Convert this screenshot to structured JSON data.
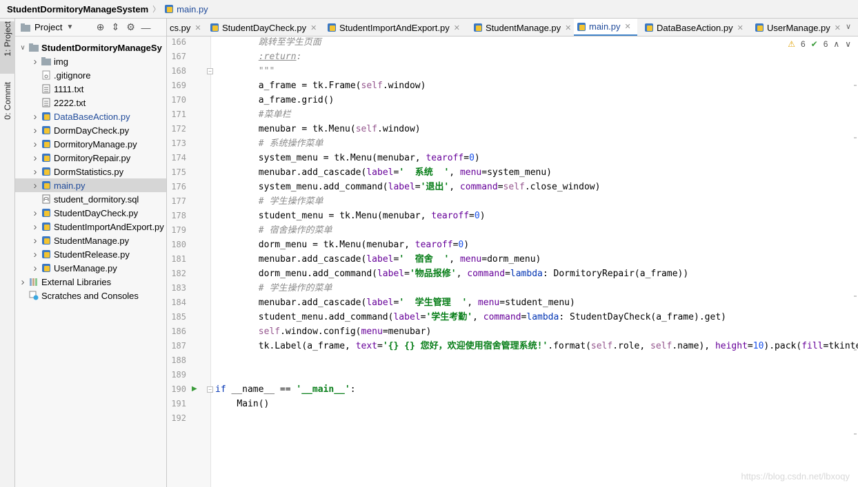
{
  "navbar": {
    "project": "StudentDormitoryManageSystem",
    "file": "main.py"
  },
  "toolstrip": {
    "project_tab": "1: Project",
    "commit_tab": "0: Commit"
  },
  "project_panel": {
    "title": "Project",
    "tree": [
      {
        "label": "StudentDormitoryManageSy",
        "icon": "folder-icon",
        "arrow": "expanded",
        "indent": 0,
        "bold": true
      },
      {
        "label": "img",
        "icon": "folder-icon",
        "arrow": "collapsed",
        "indent": 1
      },
      {
        "label": ".gitignore",
        "icon": "file-icon",
        "arrow": "",
        "indent": 1
      },
      {
        "label": "1111.txt",
        "icon": "text-file-icon",
        "arrow": "",
        "indent": 1
      },
      {
        "label": "2222.txt",
        "icon": "text-file-icon",
        "arrow": "",
        "indent": 1
      },
      {
        "label": "DataBaseAction.py",
        "icon": "python-file-icon",
        "arrow": "collapsed",
        "indent": 1,
        "color": "#1f4a9a"
      },
      {
        "label": "DormDayCheck.py",
        "icon": "python-file-icon",
        "arrow": "collapsed",
        "indent": 1
      },
      {
        "label": "DormitoryManage.py",
        "icon": "python-file-icon",
        "arrow": "collapsed",
        "indent": 1
      },
      {
        "label": "DormitoryRepair.py",
        "icon": "python-file-icon",
        "arrow": "collapsed",
        "indent": 1
      },
      {
        "label": "DormStatistics.py",
        "icon": "python-file-icon",
        "arrow": "collapsed",
        "indent": 1
      },
      {
        "label": "main.py",
        "icon": "python-file-icon",
        "arrow": "collapsed",
        "indent": 1,
        "color": "#1f4a9a",
        "selected": true
      },
      {
        "label": "student_dormitory.sql",
        "icon": "sql-file-icon",
        "arrow": "",
        "indent": 1
      },
      {
        "label": "StudentDayCheck.py",
        "icon": "python-file-icon",
        "arrow": "collapsed",
        "indent": 1
      },
      {
        "label": "StudentImportAndExport.py",
        "icon": "python-file-icon",
        "arrow": "collapsed",
        "indent": 1
      },
      {
        "label": "StudentManage.py",
        "icon": "python-file-icon",
        "arrow": "collapsed",
        "indent": 1
      },
      {
        "label": "StudentRelease.py",
        "icon": "python-file-icon",
        "arrow": "collapsed",
        "indent": 1
      },
      {
        "label": "UserManage.py",
        "icon": "python-file-icon",
        "arrow": "collapsed",
        "indent": 1
      },
      {
        "label": "External Libraries",
        "icon": "library-icon",
        "arrow": "collapsed",
        "indent": 0
      },
      {
        "label": "Scratches and Consoles",
        "icon": "scratches-icon",
        "arrow": "",
        "indent": 0
      }
    ]
  },
  "tabs": [
    {
      "label": "cs.py",
      "active": false,
      "icon": false
    },
    {
      "label": "StudentDayCheck.py",
      "active": false,
      "icon": true
    },
    {
      "label": "StudentImportAndExport.py",
      "active": false,
      "icon": true
    },
    {
      "label": "StudentManage.py",
      "active": false,
      "icon": true
    },
    {
      "label": "main.py",
      "active": true,
      "icon": true
    },
    {
      "label": "DataBaseAction.py",
      "active": false,
      "icon": true
    },
    {
      "label": "UserManage.py",
      "active": false,
      "icon": true
    }
  ],
  "inspections": {
    "warnings": "6",
    "weak_warnings": "6"
  },
  "editor": {
    "lines": [
      {
        "n": "166",
        "indent": 8,
        "tokens": [
          [
            "doc",
            "跳转至学生页面"
          ]
        ]
      },
      {
        "n": "167",
        "indent": 8,
        "tokens": [
          [
            "doctag",
            ":return"
          ],
          [
            "doc",
            ":"
          ]
        ]
      },
      {
        "n": "168",
        "indent": 8,
        "tokens": [
          [
            "doc",
            "\"\"\""
          ]
        ]
      },
      {
        "n": "169",
        "indent": 8,
        "tokens": [
          [
            "",
            "a_frame = tk.Frame("
          ],
          [
            "self",
            "self"
          ],
          [
            "",
            ".window)"
          ]
        ]
      },
      {
        "n": "170",
        "indent": 8,
        "tokens": [
          [
            "",
            "a_frame.grid()"
          ]
        ]
      },
      {
        "n": "171",
        "indent": 8,
        "tokens": [
          [
            "cmt",
            "#菜单栏"
          ]
        ]
      },
      {
        "n": "172",
        "indent": 8,
        "tokens": [
          [
            "",
            "menubar = tk.Menu("
          ],
          [
            "self",
            "self"
          ],
          [
            "",
            ".window)"
          ]
        ]
      },
      {
        "n": "173",
        "indent": 8,
        "tokens": [
          [
            "cmt",
            "# 系统操作菜单"
          ]
        ]
      },
      {
        "n": "174",
        "indent": 8,
        "tokens": [
          [
            "",
            "system_menu = tk.Menu(menubar, "
          ],
          [
            "param",
            "tearoff"
          ],
          [
            "",
            "="
          ],
          [
            "num",
            "0"
          ],
          [
            "",
            ")"
          ]
        ]
      },
      {
        "n": "175",
        "indent": 8,
        "tokens": [
          [
            "",
            "menubar.add_cascade("
          ],
          [
            "param",
            "label"
          ],
          [
            "",
            "="
          ],
          [
            "str",
            "'  系统  '"
          ],
          [
            "",
            ", "
          ],
          [
            "param",
            "menu"
          ],
          [
            "",
            "=system_menu)"
          ]
        ]
      },
      {
        "n": "176",
        "indent": 8,
        "tokens": [
          [
            "",
            "system_menu.add_command("
          ],
          [
            "param",
            "label"
          ],
          [
            "",
            "="
          ],
          [
            "str",
            "'退出'"
          ],
          [
            "",
            ", "
          ],
          [
            "param",
            "command"
          ],
          [
            "",
            "="
          ],
          [
            "self",
            "self"
          ],
          [
            "",
            ".close_window)"
          ]
        ]
      },
      {
        "n": "177",
        "indent": 8,
        "tokens": [
          [
            "cmt",
            "# 学生操作菜单"
          ]
        ]
      },
      {
        "n": "178",
        "indent": 8,
        "tokens": [
          [
            "",
            "student_menu = tk.Menu(menubar, "
          ],
          [
            "param",
            "tearoff"
          ],
          [
            "",
            "="
          ],
          [
            "num",
            "0"
          ],
          [
            "",
            ")"
          ]
        ]
      },
      {
        "n": "179",
        "indent": 8,
        "tokens": [
          [
            "cmt",
            "# 宿舍操作的菜单"
          ]
        ]
      },
      {
        "n": "180",
        "indent": 8,
        "tokens": [
          [
            "",
            "dorm_menu = tk.Menu(menubar, "
          ],
          [
            "param",
            "tearoff"
          ],
          [
            "",
            "="
          ],
          [
            "num",
            "0"
          ],
          [
            "",
            ")"
          ]
        ]
      },
      {
        "n": "181",
        "indent": 8,
        "tokens": [
          [
            "",
            "menubar.add_cascade("
          ],
          [
            "param",
            "label"
          ],
          [
            "",
            "="
          ],
          [
            "str",
            "'  宿舍  '"
          ],
          [
            "",
            ", "
          ],
          [
            "param",
            "menu"
          ],
          [
            "",
            "=dorm_menu)"
          ]
        ]
      },
      {
        "n": "182",
        "indent": 8,
        "tokens": [
          [
            "",
            "dorm_menu.add_command("
          ],
          [
            "param",
            "label"
          ],
          [
            "",
            "="
          ],
          [
            "str",
            "'物品报修'"
          ],
          [
            "",
            ", "
          ],
          [
            "param",
            "command"
          ],
          [
            "",
            "="
          ],
          [
            "kw",
            "lambda"
          ],
          [
            "",
            ": DormitoryRepair(a_frame))"
          ]
        ]
      },
      {
        "n": "183",
        "indent": 8,
        "tokens": [
          [
            "cmt",
            "# 学生操作的菜单"
          ]
        ]
      },
      {
        "n": "184",
        "indent": 8,
        "tokens": [
          [
            "",
            "menubar.add_cascade("
          ],
          [
            "param",
            "label"
          ],
          [
            "",
            "="
          ],
          [
            "str",
            "'  学生管理  '"
          ],
          [
            "",
            ", "
          ],
          [
            "param",
            "menu"
          ],
          [
            "",
            "=student_menu)"
          ]
        ]
      },
      {
        "n": "185",
        "indent": 8,
        "tokens": [
          [
            "",
            "student_menu.add_command("
          ],
          [
            "param",
            "label"
          ],
          [
            "",
            "="
          ],
          [
            "str",
            "'学生考勤'"
          ],
          [
            "",
            ", "
          ],
          [
            "param",
            "command"
          ],
          [
            "",
            "="
          ],
          [
            "kw",
            "lambda"
          ],
          [
            "",
            ": StudentDayCheck(a_frame).get)"
          ]
        ]
      },
      {
        "n": "186",
        "indent": 8,
        "tokens": [
          [
            "self",
            "self"
          ],
          [
            "",
            ".window.config("
          ],
          [
            "param",
            "menu"
          ],
          [
            "",
            "=menubar)"
          ]
        ]
      },
      {
        "n": "187",
        "indent": 8,
        "tokens": [
          [
            "",
            "tk.Label(a_frame, "
          ],
          [
            "param",
            "text"
          ],
          [
            "",
            "="
          ],
          [
            "str",
            "'{} {} 您好，欢迎使用宿舍管理系统!'"
          ],
          [
            "",
            ".format("
          ],
          [
            "self",
            "self"
          ],
          [
            "",
            ".role, "
          ],
          [
            "self",
            "self"
          ],
          [
            "",
            ".name), "
          ],
          [
            "param",
            "height"
          ],
          [
            "",
            "="
          ],
          [
            "num",
            "10"
          ],
          [
            "",
            ").pack("
          ],
          [
            "param",
            "fill"
          ],
          [
            "",
            "=tkinter"
          ]
        ]
      },
      {
        "n": "188",
        "indent": 0,
        "tokens": []
      },
      {
        "n": "189",
        "indent": 0,
        "tokens": []
      },
      {
        "n": "190",
        "indent": 0,
        "run": true,
        "tokens": [
          [
            "kw",
            "if"
          ],
          [
            "",
            " __name__ == "
          ],
          [
            "str",
            "'__main__'"
          ],
          [
            "",
            ":"
          ]
        ]
      },
      {
        "n": "191",
        "indent": 4,
        "tokens": [
          [
            "",
            "Main()"
          ]
        ]
      },
      {
        "n": "192",
        "indent": 0,
        "tokens": []
      }
    ]
  },
  "watermark": "https://blog.csdn.net/lbxoqy"
}
